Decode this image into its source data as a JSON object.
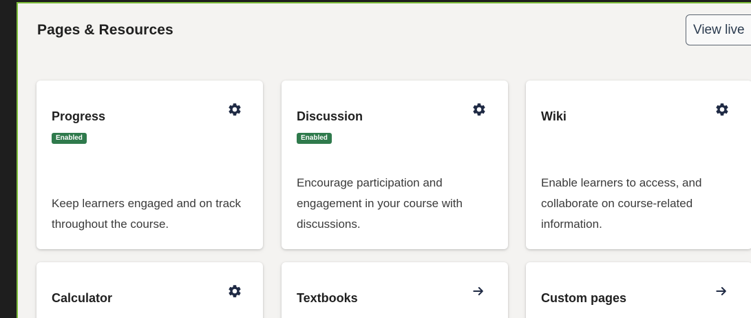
{
  "header": {
    "title": "Pages & Resources",
    "view_live_label": "View live"
  },
  "cards": [
    {
      "title": "Progress",
      "badge": "Enabled",
      "description": "Keep learners engaged and on track throughout the course.",
      "action_icon": "gear-icon"
    },
    {
      "title": "Discussion",
      "badge": "Enabled",
      "description": "Encourage participation and engagement in your course with discussions.",
      "action_icon": "gear-icon"
    },
    {
      "title": "Wiki",
      "description": "Enable learners to access, and collaborate on course-related information.",
      "action_icon": "gear-icon"
    },
    {
      "title": "Calculator",
      "action_icon": "gear-icon"
    },
    {
      "title": "Textbooks",
      "action_icon": "arrow-right-icon"
    },
    {
      "title": "Custom pages",
      "action_icon": "arrow-right-icon"
    }
  ],
  "colors": {
    "badge_enabled": "#2f7a4c",
    "icon": "#1f2a44",
    "frame_border": "#7dbd3a"
  }
}
